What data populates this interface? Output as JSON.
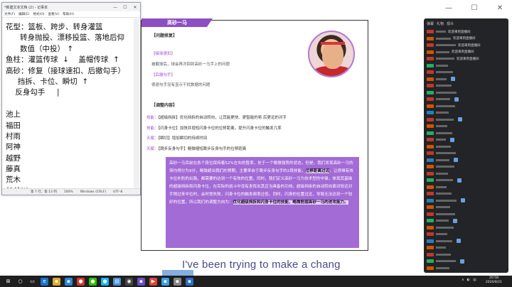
{
  "chrome": {
    "minimize_label": "—",
    "maximize_label": "☐",
    "close_label": "✕"
  },
  "notepad": {
    "title": "*新建文本文档 (2) - 记事本",
    "menu": [
      "文件(F)",
      "编辑(E)",
      "格式(O)",
      "查看(V)",
      "帮助(H)"
    ],
    "lines": [
      "花型：篮板、跨步、转身灌篮",
      "      转身抛投、漂移投篮、落地后仰",
      "      数值（中投） ↑",
      "鱼柱：灌篮传球  ↓    盖帽传球  ↑",
      "高砂：修复（接球速扣、后撤勾手）",
      "     挡拆、卡位、瞬切  ↑",
      "    反身勾手     |",
      "",
      "池上",
      "福田",
      "村雨",
      "阿神",
      "越野",
      "藤真",
      "荒木",
      "长谷川"
    ],
    "status": [
      "第 7 行，第 13 列",
      "100%",
      "Windows (CRLF)",
      "UTF-8"
    ]
  },
  "doc": {
    "header": "高砂一马",
    "section1_title": "【问题修复】",
    "sub1_label": "【接球速扣】",
    "sub1_text": "被截球后，球会再次回到高砂一马手上的问题",
    "sub2_label": "【后撤勾手】",
    "sub2_text": "很退勾手没有显示干扰数据的问题",
    "section2_title": "【调整内容】",
    "skills": [
      {
        "tag": "技能：",
        "text": "【超级挡拆】优化挡拆的自动转向，让其能更快、更智能的将 后更远的对手"
      },
      {
        "tag": "技能：",
        "text": "【闪身卡位】加快并增短闪身卡位的位移距离，提升闪身卡位的触发几率"
      },
      {
        "tag": "天赋：",
        "text": "【瞬切】增加瞬切的持续时间"
      },
      {
        "tag": "天赋：",
        "text": "【跳步反身勾手】略微缩短跳步反身勾手的位移距离"
      }
    ],
    "purple_text": "高砂一马目前在各个段位保持着52%左右的胜率，处于一个略微强势的状态，但是，我们发现高砂一马的场均得分为9分，略微超出我们的预期，主要来自于跳步反身勾手的2段技能，",
    "purple_bold_1": "位移距离过远",
    "purple_text_2": "，让很难有效卡位补防的出路，都需要的达到一个有效的位置。同时，我们定义高砂一马为技术型的中锋，体现其基础的超级挡拆和闪身卡位，在实际的战斗中没有发挥出其应当具备的功效。超级挡拆的自动转向面对较远对手稍过来中位时，会时常失败，闪身卡位的触发频率过低，同时，闪身的位置过远，导致无法达到一个较好的位置。所以我们的调整方向为：",
    "purple_bold_2": "优化超级挡拆和闪身卡位的技能，略微削弱高砂一马的进攻能力。"
  },
  "subtitle": "I've been trying to make a chang",
  "panel": {
    "tabs": [
      "弹幕",
      "礼物",
      "观众"
    ],
    "rows": [
      {
        "text": "欢迎来到直播间",
        "badge": "#c0392b"
      },
      {
        "text": "欢迎来到直播间",
        "badge": "#d35400"
      },
      {
        "text": "欢迎来到直播间",
        "badge": "#c0392b"
      },
      {
        "text": "欢迎来到直播间",
        "badge": "#d35400"
      },
      {
        "text": "欢迎来到直播间",
        "badge": "#c0392b"
      },
      {
        "text": "",
        "badge": "#27ae60"
      },
      {
        "text": "",
        "badge": "#c0392b"
      },
      {
        "text": "",
        "badge": "#d35400"
      },
      {
        "text": "",
        "badge": "#c0392b"
      },
      {
        "text": "",
        "badge": "#27ae60"
      },
      {
        "text": "",
        "badge": "#c0392b"
      },
      {
        "text": "",
        "badge": "#d35400"
      },
      {
        "text": "",
        "badge": "#2980b9"
      },
      {
        "text": "",
        "badge": "#c0392b"
      },
      {
        "text": "",
        "badge": "#d35400"
      },
      {
        "text": "",
        "badge": "#27ae60"
      },
      {
        "text": "",
        "badge": "#c0392b"
      },
      {
        "text": "",
        "badge": "#d35400"
      },
      {
        "text": "",
        "badge": "#c0392b"
      },
      {
        "text": "",
        "badge": "#2980b9"
      },
      {
        "text": "",
        "badge": "#d35400"
      },
      {
        "text": "",
        "badge": "#c0392b"
      },
      {
        "text": "",
        "badge": "#27ae60"
      },
      {
        "text": "",
        "badge": "#d35400"
      },
      {
        "text": "",
        "badge": "#c0392b"
      },
      {
        "text": "",
        "badge": "#2980b9"
      },
      {
        "text": "",
        "badge": "#d35400"
      },
      {
        "text": "",
        "badge": "#c0392b"
      },
      {
        "text": "",
        "badge": "#27ae60"
      },
      {
        "text": "",
        "badge": "#d35400"
      },
      {
        "text": "",
        "badge": "#c0392b"
      },
      {
        "text": "",
        "badge": "#2980b9"
      },
      {
        "text": "",
        "badge": "#d35400"
      },
      {
        "text": "",
        "badge": "#c0392b"
      },
      {
        "text": "",
        "badge": "#27ae60"
      },
      {
        "text": "",
        "badge": "#d35400"
      }
    ]
  },
  "taskbar": {
    "icons": [
      {
        "name": "start-icon",
        "glyph": "⊞",
        "color": "#1f1f1f"
      },
      {
        "name": "search-icon",
        "glyph": "○",
        "color": "#1f1f1f"
      },
      {
        "name": "taskview-icon",
        "glyph": "▭",
        "color": "#1f1f1f"
      },
      {
        "name": "edge-icon",
        "glyph": "e",
        "color": "#1a73c9"
      },
      {
        "name": "folder-icon",
        "glyph": "▪",
        "color": "#e0a82e"
      },
      {
        "name": "store-icon",
        "glyph": "▪",
        "color": "#2b88d8"
      },
      {
        "name": "chrome-icon",
        "glyph": "●",
        "color": "#d33a2c"
      },
      {
        "name": "wechat-icon",
        "glyph": "●",
        "color": "#2dc100"
      },
      {
        "name": "qq-icon",
        "glyph": "●",
        "color": "#12b7f5"
      },
      {
        "name": "notepad-icon",
        "glyph": "▤",
        "color": "#4a90d9"
      },
      {
        "name": "obs-icon",
        "glyph": "◉",
        "color": "#444"
      },
      {
        "name": "game-icon",
        "glyph": "▪",
        "color": "#6a4fc4"
      },
      {
        "name": "video-icon",
        "glyph": "▶",
        "color": "#e0433a"
      },
      {
        "name": "app-icon",
        "glyph": "▪",
        "color": "#3aa0e0"
      },
      {
        "name": "app2-icon",
        "glyph": "▪",
        "color": "#888"
      },
      {
        "name": "app3-icon",
        "glyph": "▪",
        "color": "#2b6fc4"
      }
    ],
    "tray": [
      "∧",
      "◐",
      "中"
    ],
    "time": "20:58",
    "date": "2020/8/21"
  }
}
